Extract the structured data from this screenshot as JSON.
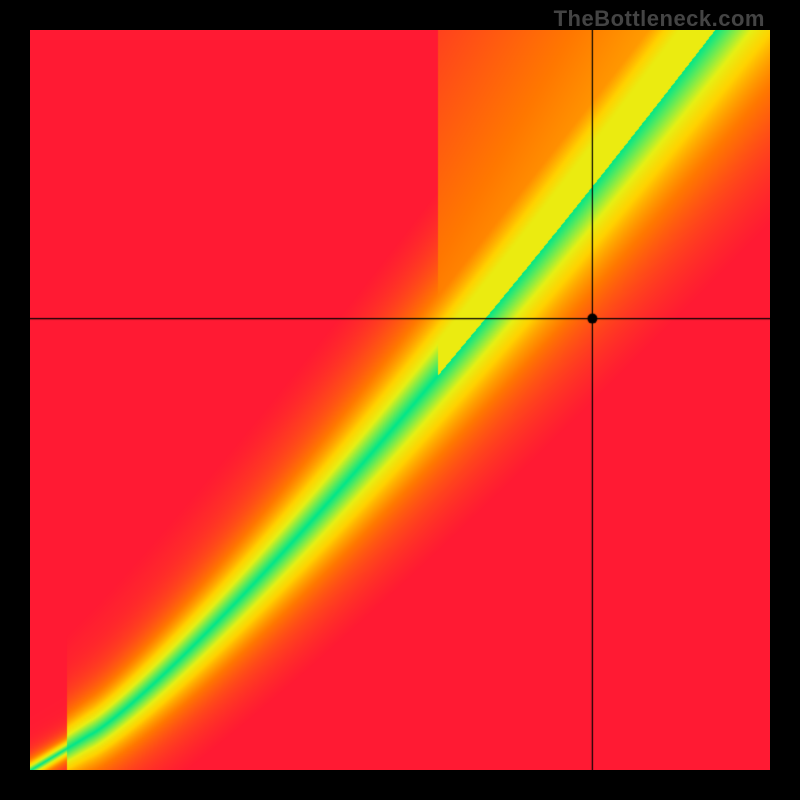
{
  "watermark": "TheBottleneck.com",
  "chart_data": {
    "type": "heatmap",
    "title": "",
    "xlabel": "",
    "ylabel": "",
    "xlim": [
      0,
      1
    ],
    "ylim": [
      0,
      1
    ],
    "crosshair": {
      "x": 0.76,
      "y": 0.61
    },
    "marker": {
      "x": 0.76,
      "y": 0.61
    },
    "ridge_description": "Diagonal green band from bottom-left to top-right representing balanced component pairing; warm colors (yellow/orange/red) indicate bottleneck regions on either side of the ridge.",
    "colors": {
      "cold": "#ff1a33",
      "warm": "#ffcc00",
      "hot": "#00e68a"
    }
  }
}
